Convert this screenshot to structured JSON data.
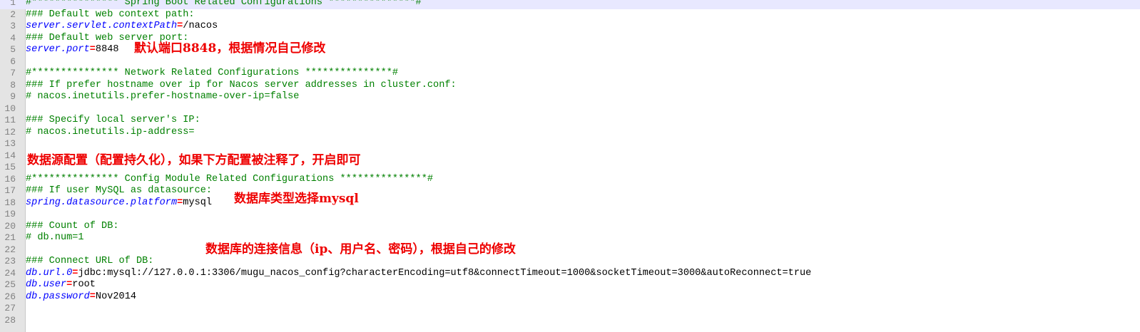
{
  "editor": {
    "lines": [
      {
        "num": "1",
        "text": "#*************** Spring Boot Related Configurations ***************#",
        "type": "comment",
        "current": true
      },
      {
        "num": "2",
        "text": "### Default web context path:",
        "type": "comment"
      },
      {
        "num": "3",
        "key": "server.servlet.contextPath",
        "value": "/nacos",
        "type": "property"
      },
      {
        "num": "4",
        "text": "### Default web server port:",
        "type": "comment"
      },
      {
        "num": "5",
        "key": "server.port",
        "value": "8848",
        "type": "property"
      },
      {
        "num": "6",
        "text": "",
        "type": "blank"
      },
      {
        "num": "7",
        "text": "#*************** Network Related Configurations ***************#",
        "type": "comment"
      },
      {
        "num": "8",
        "text": "### If prefer hostname over ip for Nacos server addresses in cluster.conf:",
        "type": "comment"
      },
      {
        "num": "9",
        "text": "# nacos.inetutils.prefer-hostname-over-ip=false",
        "type": "comment"
      },
      {
        "num": "10",
        "text": "",
        "type": "blank"
      },
      {
        "num": "11",
        "text": "### Specify local server's IP:",
        "type": "comment"
      },
      {
        "num": "12",
        "text": "# nacos.inetutils.ip-address=",
        "type": "comment"
      },
      {
        "num": "13",
        "text": "",
        "type": "blank"
      },
      {
        "num": "14",
        "text": "",
        "type": "blank"
      },
      {
        "num": "15",
        "text": "",
        "type": "blank"
      },
      {
        "num": "16",
        "text": "#*************** Config Module Related Configurations ***************#",
        "type": "comment"
      },
      {
        "num": "17",
        "text": "### If user MySQL as datasource:",
        "type": "comment"
      },
      {
        "num": "18",
        "key": "spring.datasource.platform",
        "value": "mysql",
        "type": "property"
      },
      {
        "num": "19",
        "text": "",
        "type": "blank"
      },
      {
        "num": "20",
        "text": "### Count of DB:",
        "type": "comment"
      },
      {
        "num": "21",
        "text": "# db.num=1",
        "type": "comment"
      },
      {
        "num": "22",
        "text": "",
        "type": "blank"
      },
      {
        "num": "23",
        "text": "### Connect URL of DB:",
        "type": "comment"
      },
      {
        "num": "24",
        "key": "db.url.0",
        "value": "jdbc:mysql://127.0.0.1:3306/mugu_nacos_config?characterEncoding=utf8&connectTimeout=1000&socketTimeout=3000&autoReconnect=true",
        "type": "property"
      },
      {
        "num": "25",
        "key": "db.user",
        "value": "root",
        "type": "property"
      },
      {
        "num": "26",
        "key": "db.password",
        "value": "Nov2014",
        "type": "property"
      },
      {
        "num": "27",
        "text": "",
        "type": "blank"
      },
      {
        "num": "28",
        "text": "",
        "type": "blank"
      }
    ],
    "equals_sign": "="
  },
  "annotations": {
    "port_note": "默认端口8848，根据情况自己修改",
    "datasource_note": "数据源配置（配置持久化），如果下方配置被注释了，开启即可",
    "db_type_note": "数据库类型选择mysql",
    "connection_note": "数据库的连接信息（ip、用户名、密码），根据自己的修改"
  },
  "colors": {
    "comment": "#008000",
    "key": "#0000ff",
    "equals": "#ff0000",
    "value": "#000000",
    "annotation": "#ee0000",
    "gutter": "#e4e4e4",
    "current_line": "#e8e8ff"
  }
}
